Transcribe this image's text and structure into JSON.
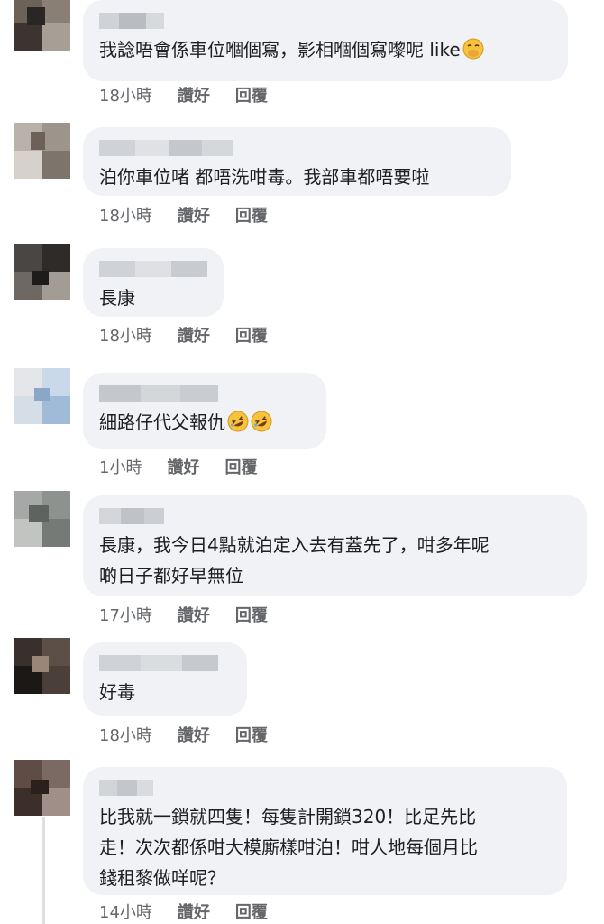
{
  "comments": [
    {
      "text": "我諗唔會係車位嗰個寫，影相嗰個寫嚟呢 like",
      "emoji": "hand-over-mouth",
      "time": "18小時",
      "like": "讚好",
      "reply": "回覆"
    },
    {
      "text": "泊你車位啫 都唔洗咁毒。我部車都唔要啦",
      "time": "18小時",
      "like": "讚好",
      "reply": "回覆"
    },
    {
      "text": "長康",
      "time": "18小時",
      "like": "讚好",
      "reply": "回覆"
    },
    {
      "text": "細路仔代父報仇",
      "emoji": "rolling-on-floor-laughing x2",
      "time": "1小時",
      "like": "讚好",
      "reply": "回覆"
    },
    {
      "text": "長康，我今日4點就泊定入去有蓋先了，咁多年呢\n啲日子都好早無位",
      "time": "17小時",
      "like": "讚好",
      "reply": "回覆"
    },
    {
      "text": "好毒",
      "time": "18小時",
      "like": "讚好",
      "reply": "回覆"
    },
    {
      "text": "比我就一鎖就四隻！每隻計開鎖320！比足先比\n走！次次都係咁大模廝樣咁泊！咁人地每個月比\n錢租黎做咩呢？",
      "time": "14小時",
      "like": "讚好",
      "reply": "回覆"
    }
  ],
  "colors": {
    "bubble": "#f0f2f5",
    "meta": "#65676b",
    "text": "#1c1e21"
  }
}
